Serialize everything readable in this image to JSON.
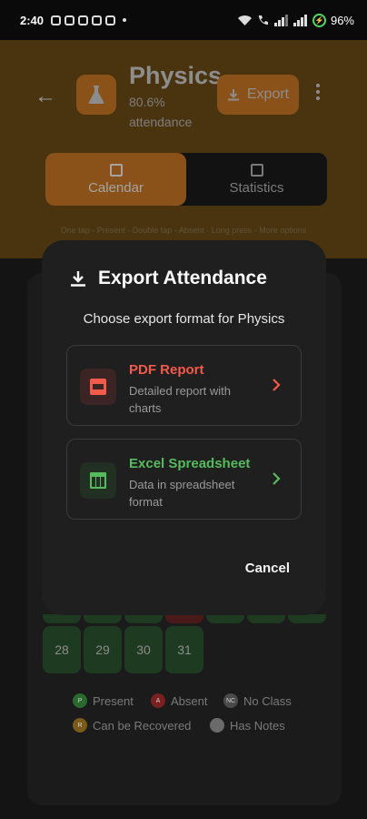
{
  "status_bar": {
    "time": "2:40",
    "battery": "96%"
  },
  "header": {
    "title": "Physics",
    "attendance_percent": "80.6%",
    "attendance_label": "attendance",
    "export_label": "Export"
  },
  "tabs": [
    {
      "label": "Calendar",
      "active": true
    },
    {
      "label": "Statistics",
      "active": false
    }
  ],
  "hint": "One tap - Present · Double tap - Absent · Long press - More options",
  "calendar": {
    "visible_days": [
      "28",
      "29",
      "30",
      "31"
    ]
  },
  "legend": [
    {
      "badge": "P",
      "label": "Present",
      "color": "#2a6a2f"
    },
    {
      "badge": "A",
      "label": "Absent",
      "color": "#7a2020"
    },
    {
      "badge": "NC",
      "label": "No Class",
      "color": "#4a4a4a"
    },
    {
      "badge": "R",
      "label": "Can be Recovered",
      "color": "#7a5a18"
    },
    {
      "badge": "",
      "label": "Has Notes",
      "color": "#6a6a6a"
    }
  ],
  "dialog": {
    "title": "Export Attendance",
    "subtitle": "Choose export format for Physics",
    "options": [
      {
        "title": "PDF Report",
        "description": "Detailed report with charts",
        "icon": "pdf-icon",
        "color": "#f25a4a"
      },
      {
        "title": "Excel Spreadsheet",
        "description": "Data in spreadsheet format",
        "icon": "table-icon",
        "color": "#56bb5c"
      }
    ],
    "cancel_label": "Cancel"
  }
}
